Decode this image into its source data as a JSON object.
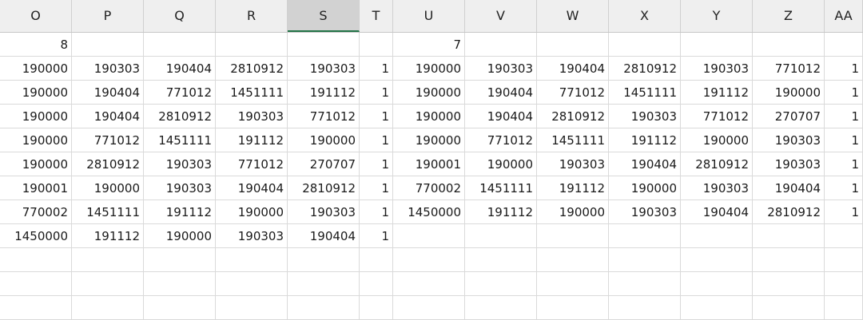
{
  "columns": [
    "O",
    "P",
    "Q",
    "R",
    "S",
    "T",
    "U",
    "V",
    "W",
    "X",
    "Y",
    "Z",
    "AA"
  ],
  "selected_column": "S",
  "rows": [
    [
      "8",
      "",
      "",
      "",
      "",
      "",
      "7",
      "",
      "",
      "",
      "",
      "",
      ""
    ],
    [
      "190000",
      "190303",
      "190404",
      "2810912",
      "190303",
      "1",
      "190000",
      "190303",
      "190404",
      "2810912",
      "190303",
      "771012",
      "1"
    ],
    [
      "190000",
      "190404",
      "771012",
      "1451111",
      "191112",
      "1",
      "190000",
      "190404",
      "771012",
      "1451111",
      "191112",
      "190000",
      "1"
    ],
    [
      "190000",
      "190404",
      "2810912",
      "190303",
      "771012",
      "1",
      "190000",
      "190404",
      "2810912",
      "190303",
      "771012",
      "270707",
      "1"
    ],
    [
      "190000",
      "771012",
      "1451111",
      "191112",
      "190000",
      "1",
      "190000",
      "771012",
      "1451111",
      "191112",
      "190000",
      "190303",
      "1"
    ],
    [
      "190000",
      "2810912",
      "190303",
      "771012",
      "270707",
      "1",
      "190001",
      "190000",
      "190303",
      "190404",
      "2810912",
      "190303",
      "1"
    ],
    [
      "190001",
      "190000",
      "190303",
      "190404",
      "2810912",
      "1",
      "770002",
      "1451111",
      "191112",
      "190000",
      "190303",
      "190404",
      "1"
    ],
    [
      "770002",
      "1451111",
      "191112",
      "190000",
      "190303",
      "1",
      "1450000",
      "191112",
      "190000",
      "190303",
      "190404",
      "2810912",
      "1"
    ],
    [
      "1450000",
      "191112",
      "190000",
      "190303",
      "190404",
      "1",
      "",
      "",
      "",
      "",
      "",
      "",
      ""
    ],
    [
      "",
      "",
      "",
      "",
      "",
      "",
      "",
      "",
      "",
      "",
      "",
      "",
      ""
    ],
    [
      "",
      "",
      "",
      "",
      "",
      "",
      "",
      "",
      "",
      "",
      "",
      "",
      ""
    ],
    [
      "",
      "",
      "",
      "",
      "",
      "",
      "",
      "",
      "",
      "",
      "",
      "",
      ""
    ]
  ]
}
